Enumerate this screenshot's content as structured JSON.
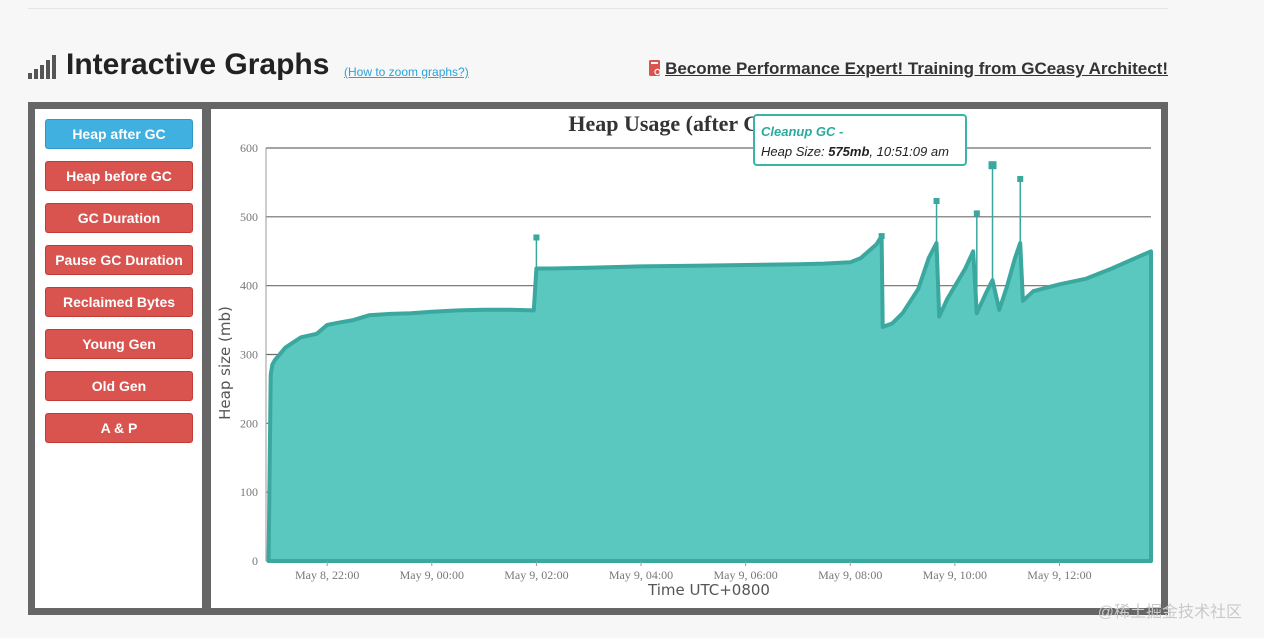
{
  "header": {
    "title": "Interactive Graphs",
    "zoom_link": "(How to zoom graphs?)",
    "training_link": "Become Performance Expert! Training from GCeasy Architect!"
  },
  "sidebar": {
    "buttons": [
      {
        "label": "Heap after GC",
        "active": true
      },
      {
        "label": "Heap before GC",
        "active": false
      },
      {
        "label": "GC Duration",
        "active": false
      },
      {
        "label": "Pause GC Duration",
        "active": false
      },
      {
        "label": "Reclaimed Bytes",
        "active": false
      },
      {
        "label": "Young Gen",
        "active": false
      },
      {
        "label": "Old Gen",
        "active": false
      },
      {
        "label": "A & P",
        "active": false
      }
    ]
  },
  "tooltip": {
    "title": "Cleanup GC -",
    "label": "Heap Size:",
    "value": "575mb",
    "time": ", 10:51:09 am"
  },
  "watermark": "@稀土掘金技术社区",
  "colors": {
    "area_fill": "#5ac8bf",
    "area_line": "#3aa89e",
    "active_button": "#3fb0e0",
    "button_red": "#d9534f"
  },
  "chart_data": {
    "type": "area",
    "title": "Heap Usage (after GC)",
    "xlabel": "Time UTC+0800",
    "ylabel": "Heap size (mb)",
    "ylim": [
      0,
      600
    ],
    "yticks": [
      0,
      100,
      200,
      300,
      400,
      500,
      600
    ],
    "xlim_hours": [
      20.83,
      37.75
    ],
    "xticks": [
      {
        "label": "May 8, 22:00",
        "hour": 22
      },
      {
        "label": "May 9, 00:00",
        "hour": 24
      },
      {
        "label": "May 9, 02:00",
        "hour": 26
      },
      {
        "label": "May 9, 04:00",
        "hour": 28
      },
      {
        "label": "May 9, 06:00",
        "hour": 30
      },
      {
        "label": "May 9, 08:00",
        "hour": 32
      },
      {
        "label": "May 9, 10:00",
        "hour": 34
      },
      {
        "label": "May 9, 12:00",
        "hour": 36
      }
    ],
    "grid": true,
    "series": [
      {
        "x": [
          20.88,
          20.92,
          20.95,
          21.0,
          21.2,
          21.5,
          21.8,
          22.0,
          22.2,
          22.5,
          22.8,
          23.2,
          23.6,
          24.0,
          24.5,
          25.0,
          25.5,
          25.95,
          26.0,
          26.3,
          27.0,
          28.0,
          29.0,
          30.0,
          31.0,
          31.5,
          32.0,
          32.2,
          32.5,
          32.6,
          32.62,
          32.8,
          33.0,
          33.3,
          33.5,
          33.65,
          33.7,
          33.85,
          34.2,
          34.35,
          34.42,
          34.6,
          34.72,
          34.85,
          35.0,
          35.15,
          35.25,
          35.3,
          35.5,
          36.0,
          36.5,
          37.0,
          37.75
        ],
        "y": [
          0,
          270,
          285,
          292,
          310,
          325,
          330,
          343,
          346,
          350,
          357,
          359,
          360,
          362,
          364,
          365,
          365,
          364,
          425,
          425,
          426,
          428,
          429,
          430,
          431,
          432,
          434,
          440,
          460,
          472,
          340,
          345,
          360,
          395,
          440,
          462,
          355,
          380,
          425,
          450,
          360,
          390,
          408,
          365,
          400,
          440,
          462,
          378,
          392,
          402,
          410,
          425,
          450
        ]
      }
    ],
    "spikes": [
      {
        "x": 26.0,
        "y": 470
      },
      {
        "x": 32.6,
        "y": 472
      },
      {
        "x": 33.65,
        "y": 523
      },
      {
        "x": 34.42,
        "y": 505
      },
      {
        "x": 34.72,
        "y": 575
      },
      {
        "x": 35.25,
        "y": 555
      }
    ]
  }
}
